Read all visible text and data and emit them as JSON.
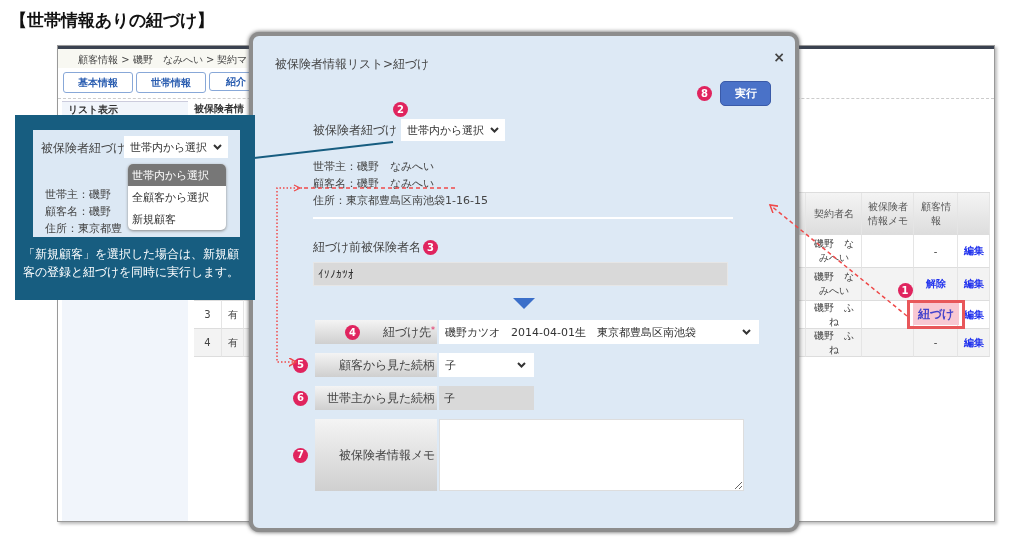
{
  "title": "【世帯情報ありの紐づけ】",
  "app": {
    "breadcrumb": "顧客情報 > 磯野　なみへい > 契約マ",
    "tabs": [
      {
        "label": "基本情報"
      },
      {
        "label": "世帯情報"
      },
      {
        "label": "紹介"
      }
    ],
    "sidebar": {
      "heading": "リスト表示"
    },
    "section_title": "被保険者情",
    "table": {
      "columns": [
        "契約者名",
        "被保険者情報メモ",
        "顧客情報"
      ],
      "rows": [
        {
          "no": "",
          "status": "",
          "contractor": "磯野　なみへい",
          "memo": "",
          "customer_info": {
            "kind": "dash",
            "label": "-"
          },
          "action": "編集"
        },
        {
          "no": "",
          "status": "",
          "contractor": "磯野　なみへい",
          "memo": "",
          "customer_info": {
            "kind": "link",
            "label": "解除"
          },
          "action": "編集"
        },
        {
          "no": "3",
          "status": "有",
          "contractor": "磯野　ふね",
          "memo": "",
          "customer_info": {
            "kind": "highlight",
            "label": "紐づけ",
            "marker": "1"
          },
          "action": "編集"
        },
        {
          "no": "4",
          "status": "有",
          "contractor": "磯野　ふね",
          "memo": "",
          "customer_info": {
            "kind": "dash",
            "label": "-"
          },
          "action": "編集"
        }
      ]
    }
  },
  "modal": {
    "title": "被保険者情報リスト>紐づけ",
    "close": "×",
    "run_button": {
      "label": "実行",
      "marker": "8"
    },
    "link_select": {
      "label": "被保険者紐づけ",
      "value": "世帯内から選択",
      "marker": "2"
    },
    "info_lines": [
      "世帯主：磯野　なみへい",
      "顧客名：磯野　なみへい",
      "住所：東京都豊島区南池袋1-16-15"
    ],
    "before_name": {
      "label": "紐づけ前被保険者名",
      "marker": "3",
      "value": "ｲｿﾉｶﾂｵ"
    },
    "fields": [
      {
        "kind": "select",
        "label": "紐づけ先",
        "required_mark": "*",
        "marker": "4",
        "value": "磯野カツオ　2014-04-01生　東京都豊島区南池袋"
      },
      {
        "kind": "select",
        "label": "顧客から見た続柄",
        "marker": "5",
        "value": "子"
      },
      {
        "kind": "readonly",
        "label": "世帯主から見た続柄",
        "marker": "6",
        "value": "子"
      },
      {
        "kind": "textarea",
        "label": "被保険者情報メモ",
        "marker": "7"
      }
    ]
  },
  "callout": {
    "label": "被保険者紐づけ",
    "value": "世帯内から選択",
    "options": [
      {
        "label": "世帯内から選択",
        "selected": true
      },
      {
        "label": "全顧客から選択",
        "selected": false
      },
      {
        "label": "新規顧客",
        "selected": false
      }
    ],
    "info_lines": [
      "世帯主：磯野",
      "顧客名：磯野",
      "住所：東京都豊"
    ],
    "note": "「新規顧客」を選択した場合は、新規顧客の登録と紐づけを同時に実行します。"
  }
}
